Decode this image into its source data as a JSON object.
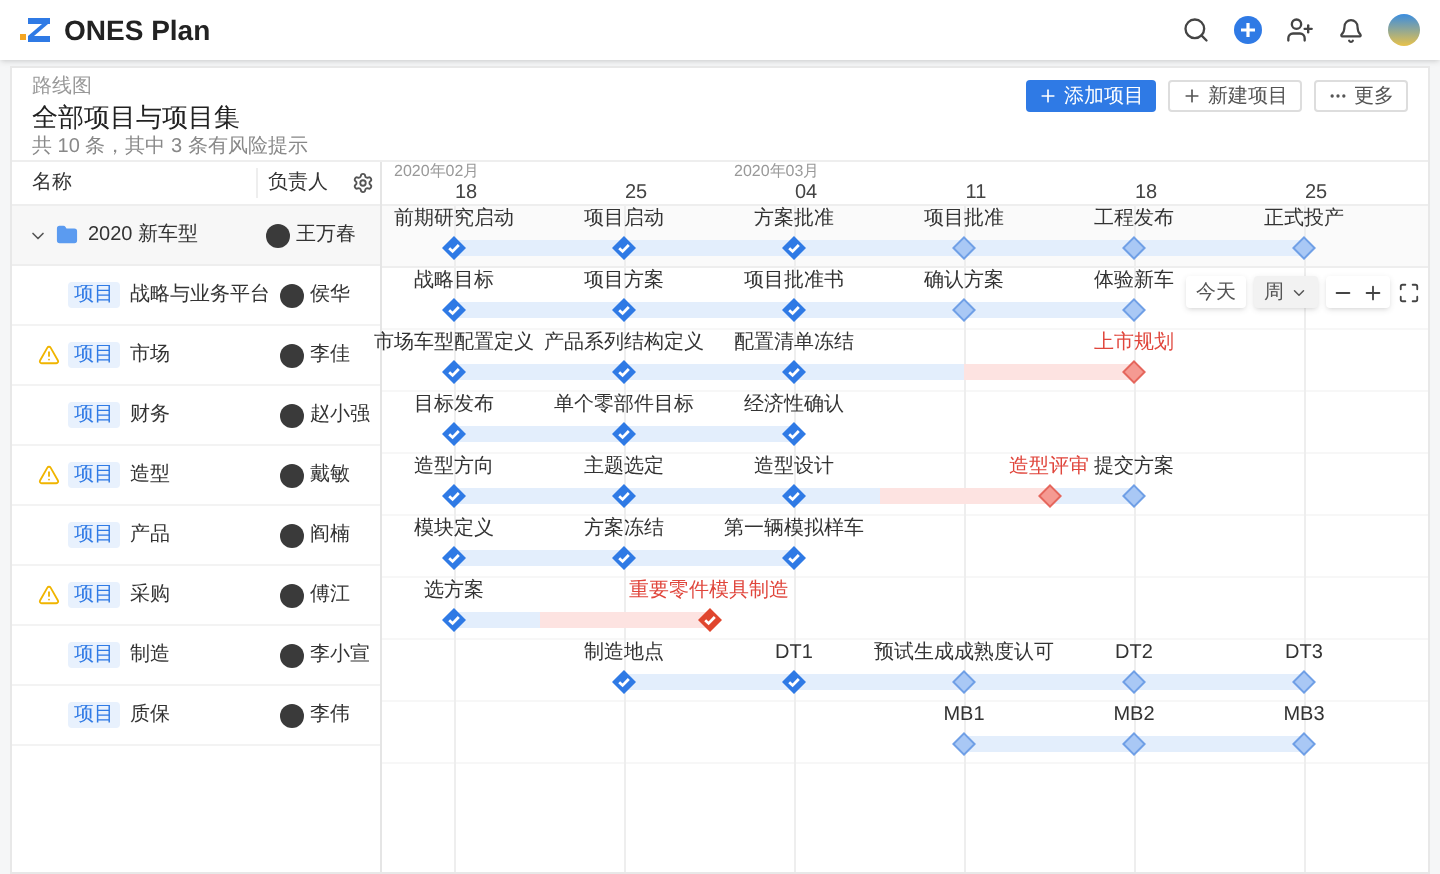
{
  "app": {
    "name": "ONES Plan"
  },
  "page": {
    "breadcrumb": "路线图",
    "title": "全部项目与项目集",
    "summary": "共 10 条，其中 3 条有风险提示"
  },
  "actions": [
    {
      "label": "添加项目",
      "kind": "primary"
    },
    {
      "label": "新建项目",
      "kind": "new"
    },
    {
      "label": "更多",
      "kind": "more"
    }
  ],
  "columns": [
    "名称",
    "负责人"
  ],
  "timeline": {
    "months": [
      {
        "label": "2020年02月",
        "weeks": [
          "18",
          "25"
        ]
      },
      {
        "label": "2020年03月",
        "weeks": [
          "04",
          "11",
          "18",
          "25"
        ]
      }
    ]
  },
  "group": {
    "name": "2020 新车型",
    "owner": "王万春",
    "expanded": true,
    "slots": [
      {
        "kind": "milestone",
        "label": "前期研究启动",
        "done": true,
        "risk": false
      },
      {
        "kind": "milestone",
        "label": "项目启动",
        "done": true,
        "risk": false
      },
      {
        "kind": "milestone",
        "label": "方案批准",
        "done": true,
        "risk": false
      },
      {
        "kind": "milestone",
        "label": "项目批准",
        "done": false,
        "risk": false
      },
      {
        "kind": "milestone",
        "label": "工程发布",
        "done": false,
        "risk": false
      },
      {
        "kind": "milestone",
        "label": "正式投产",
        "done": false,
        "risk": false
      }
    ]
  },
  "rows": [
    {
      "tag": "项目",
      "name": "战略与业务平台",
      "owner": "侯华",
      "risk": false,
      "slots": [
        {
          "kind": "milestone",
          "label": "战略目标",
          "done": true,
          "risk": false
        },
        {
          "kind": "milestone",
          "label": "项目方案",
          "done": true,
          "risk": false
        },
        {
          "kind": "milestone",
          "label": "项目批准书",
          "done": true,
          "risk": false
        },
        {
          "kind": "milestone",
          "label": "确认方案",
          "done": false,
          "risk": false
        },
        {
          "kind": "milestone",
          "label": "体验新车",
          "done": false,
          "risk": false
        }
      ]
    },
    {
      "tag": "项目",
      "name": "市场",
      "owner": "李佳",
      "risk": true,
      "slots": [
        {
          "kind": "milestone",
          "label": "市场车型配置定义",
          "done": true,
          "risk": false
        },
        {
          "kind": "milestone",
          "label": "产品系列结构定义",
          "done": true,
          "risk": false
        },
        {
          "kind": "milestone",
          "label": "配置清单冻结",
          "done": true,
          "risk": false
        },
        {
          "kind": "gap"
        },
        {
          "kind": "milestone",
          "label": "上市规划",
          "done": false,
          "risk": true
        }
      ]
    },
    {
      "tag": "项目",
      "name": "财务",
      "owner": "赵小强",
      "risk": false,
      "slots": [
        {
          "kind": "milestone",
          "label": "目标发布",
          "done": true,
          "risk": false
        },
        {
          "kind": "milestone",
          "label": "单个零部件目标",
          "done": true,
          "risk": false
        },
        {
          "kind": "milestone",
          "label": "经济性确认",
          "done": true,
          "risk": false
        }
      ]
    },
    {
      "tag": "项目",
      "name": "造型",
      "owner": "戴敏",
      "risk": true,
      "slots": [
        {
          "kind": "milestone",
          "label": "造型方向",
          "done": true,
          "risk": false
        },
        {
          "kind": "milestone",
          "label": "主题选定",
          "done": true,
          "risk": false
        },
        {
          "kind": "milestone",
          "label": "造型设计",
          "done": true,
          "risk": false
        },
        {
          "kind": "milestone",
          "label": "造型评审",
          "done": false,
          "risk": true,
          "mid": true
        },
        {
          "kind": "milestone",
          "label": "提交方案",
          "done": false,
          "risk": false
        }
      ]
    },
    {
      "tag": "项目",
      "name": "产品",
      "owner": "阎楠",
      "risk": false,
      "slots": [
        {
          "kind": "milestone",
          "label": "模块定义",
          "done": true,
          "risk": false
        },
        {
          "kind": "milestone",
          "label": "方案冻结",
          "done": true,
          "risk": false
        },
        {
          "kind": "milestone",
          "label": "第一辆模拟样车",
          "done": true,
          "risk": false
        }
      ]
    },
    {
      "tag": "项目",
      "name": "采购",
      "owner": "傅江",
      "risk": true,
      "slots": [
        {
          "kind": "milestone",
          "label": "选方案",
          "done": true,
          "risk": false
        },
        {
          "kind": "milestone",
          "label": "重要零件模具制造",
          "done": true,
          "risk": true,
          "mid": true
        }
      ]
    },
    {
      "tag": "项目",
      "name": "制造",
      "owner": "李小宣",
      "risk": false,
      "slots": [
        {
          "kind": "gap"
        },
        {
          "kind": "milestone",
          "label": "制造地点",
          "done": true,
          "risk": false
        },
        {
          "kind": "milestone",
          "label": "DT1",
          "done": true,
          "risk": false
        },
        {
          "kind": "milestone",
          "label": "预试生成成熟度认可",
          "done": false,
          "risk": false
        },
        {
          "kind": "milestone",
          "label": "DT2",
          "done": false,
          "risk": false
        },
        {
          "kind": "milestone",
          "label": "DT3",
          "done": false,
          "risk": false
        }
      ]
    },
    {
      "tag": "项目",
      "name": "质保",
      "owner": "李伟",
      "risk": false,
      "slots": [
        {
          "kind": "gap"
        },
        {
          "kind": "gap"
        },
        {
          "kind": "gap"
        },
        {
          "kind": "milestone",
          "label": "MB1",
          "done": false,
          "risk": false
        },
        {
          "kind": "milestone",
          "label": "MB2",
          "done": false,
          "risk": false
        },
        {
          "kind": "milestone",
          "label": "MB3",
          "done": false,
          "risk": false
        }
      ]
    }
  ],
  "toolbar": {
    "today": "今天",
    "scale": "周"
  }
}
